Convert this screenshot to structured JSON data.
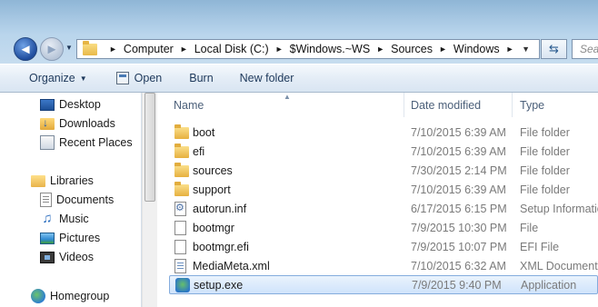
{
  "navigation": {
    "back_glyph": "◄",
    "forward_glyph": "►",
    "history_dropdown_glyph": "▼",
    "breadcrumb": [
      {
        "label": "Computer"
      },
      {
        "label": "Local Disk (C:)"
      },
      {
        "label": "$Windows.~WS"
      },
      {
        "label": "Sources"
      },
      {
        "label": "Windows"
      }
    ],
    "breadcrumb_separator": "►",
    "address_dropdown_glyph": "▼",
    "refresh_glyph": "⇆",
    "search_placeholder": "Sea"
  },
  "toolbar": {
    "organize_label": "Organize",
    "organize_caret": "▼",
    "open_label": "Open",
    "burn_label": "Burn",
    "new_folder_label": "New folder"
  },
  "sidebar": {
    "items": [
      {
        "label": "Desktop",
        "icon": "desktop-icon"
      },
      {
        "label": "Downloads",
        "icon": "downloads-icon"
      },
      {
        "label": "Recent Places",
        "icon": "recent-places-icon"
      },
      {
        "label": "Libraries",
        "icon": "libraries-icon"
      },
      {
        "label": "Documents",
        "icon": "documents-icon"
      },
      {
        "label": "Music",
        "icon": "music-icon"
      },
      {
        "label": "Pictures",
        "icon": "pictures-icon"
      },
      {
        "label": "Videos",
        "icon": "videos-icon"
      },
      {
        "label": "Homegroup",
        "icon": "homegroup-icon"
      }
    ],
    "music_glyph": "♫"
  },
  "file_list": {
    "columns": [
      "Name",
      "Date modified",
      "Type"
    ],
    "sort_glyph": "▲",
    "rows": [
      {
        "name": "boot",
        "date": "7/10/2015 6:39 AM",
        "type": "File folder",
        "icon": "folder-icon"
      },
      {
        "name": "efi",
        "date": "7/10/2015 6:39 AM",
        "type": "File folder",
        "icon": "folder-icon"
      },
      {
        "name": "sources",
        "date": "7/30/2015 2:14 PM",
        "type": "File folder",
        "icon": "folder-icon"
      },
      {
        "name": "support",
        "date": "7/10/2015 6:39 AM",
        "type": "File folder",
        "icon": "folder-icon"
      },
      {
        "name": "autorun.inf",
        "date": "6/17/2015 6:15 PM",
        "type": "Setup Information",
        "icon": "setup-info-icon"
      },
      {
        "name": "bootmgr",
        "date": "7/9/2015 10:30 PM",
        "type": "File",
        "icon": "file-icon"
      },
      {
        "name": "bootmgr.efi",
        "date": "7/9/2015 10:07 PM",
        "type": "EFI File",
        "icon": "file-icon"
      },
      {
        "name": "MediaMeta.xml",
        "date": "7/10/2015 6:32 AM",
        "type": "XML Document",
        "icon": "xml-document-icon"
      },
      {
        "name": "setup.exe",
        "date": "7/9/2015 9:40 PM",
        "type": "Application",
        "icon": "application-icon",
        "selected": true
      }
    ]
  }
}
